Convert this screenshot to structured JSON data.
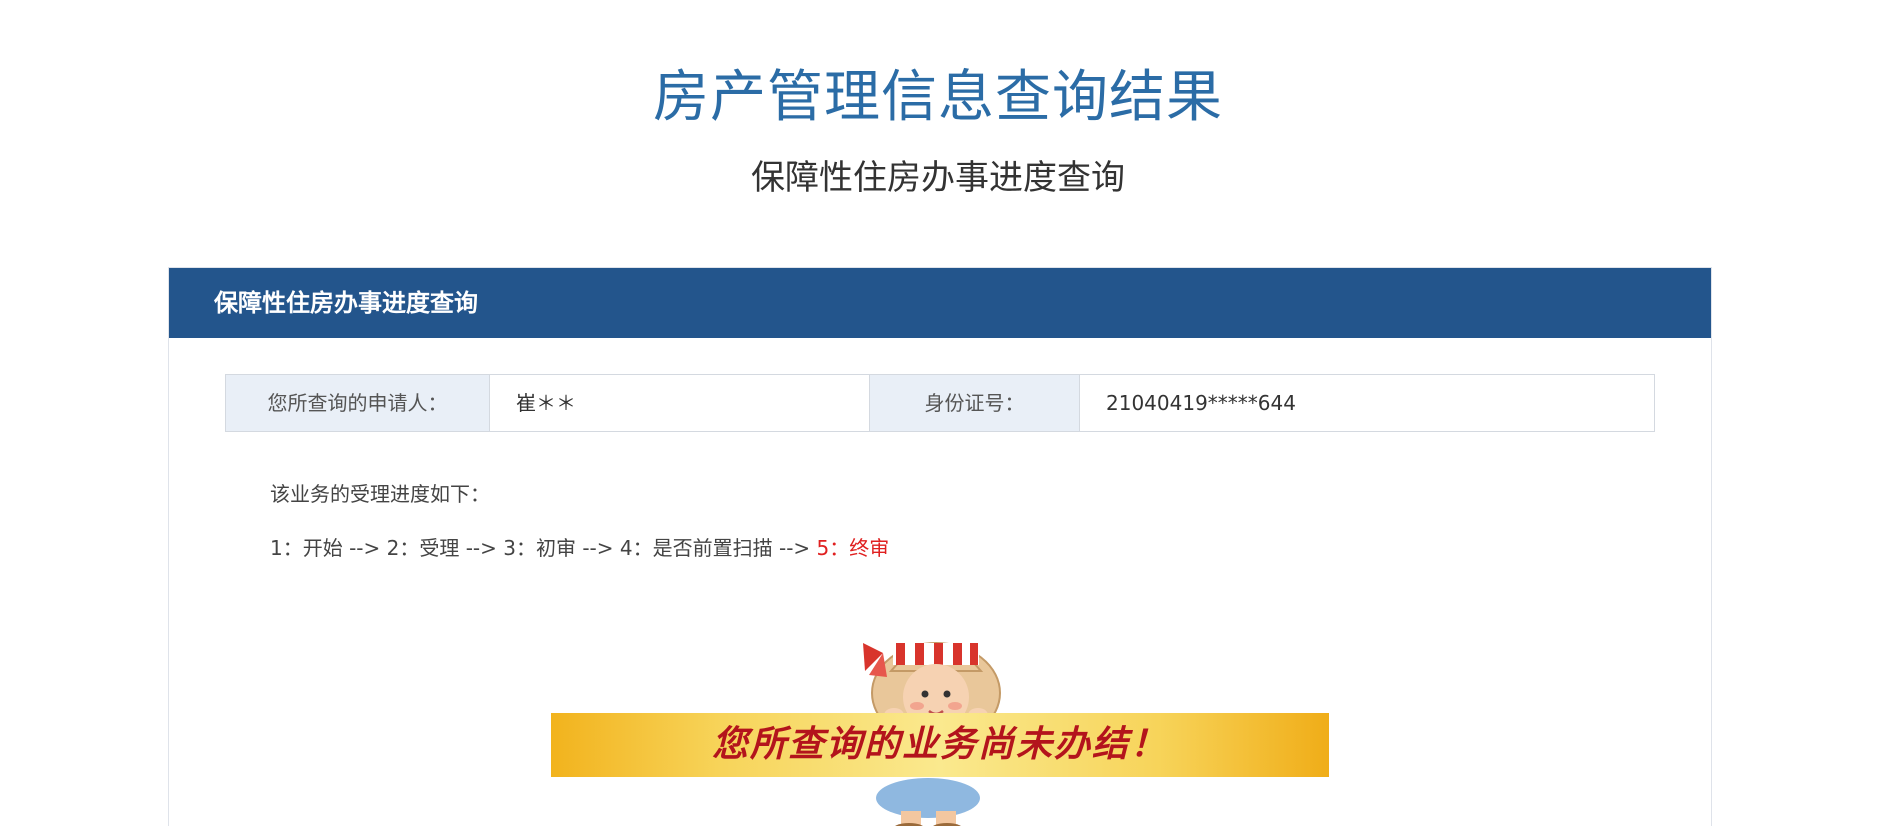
{
  "header": {
    "title": "房产管理信息查询结果",
    "subtitle": "保障性住房办事进度查询"
  },
  "panel": {
    "title": "保障性住房办事进度查询",
    "applicant_label": "您所查询的申请人：",
    "applicant_value": "崔＊＊",
    "id_label": "身份证号：",
    "id_value": "21040419*****644"
  },
  "progress": {
    "intro": "该业务的受理进度如下：",
    "steps_done": "1：开始 --> 2：受理 --> 3：初审 --> 4：是否前置扫描 --> ",
    "current_step": "5：终审"
  },
  "notice": {
    "banner_text": "您所查询的业务尚未办结！"
  },
  "colors": {
    "title_blue": "#2b6ca6",
    "header_bar": "#23558c",
    "current_step_red": "#e02020",
    "banner_text_red": "#b3141c",
    "banner_gold": "#f2b31d"
  }
}
